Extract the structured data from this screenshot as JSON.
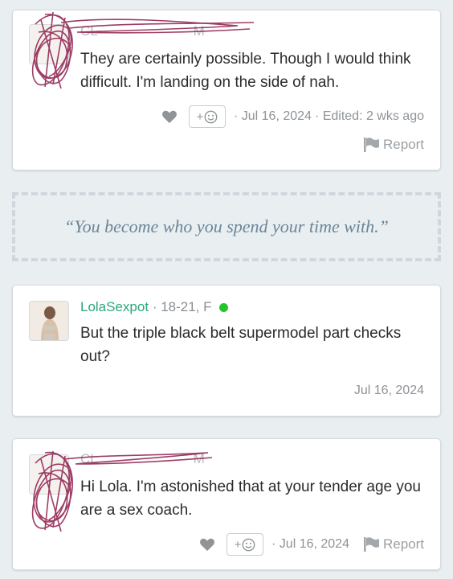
{
  "posts": [
    {
      "username_redacted": "CL",
      "meta_suffix": "M",
      "body": "They are certainly possible. Though I would think difficult. I'm landing on the side of nah.",
      "react_label": "+",
      "date": "· Jul 16, 2024",
      "edited": "· Edited: 2 wks ago",
      "report_label": "Report"
    },
    {
      "username": "LolaSexpot",
      "age_gender": "· 18-21, F",
      "body": "But the triple black belt supermodel part checks out?",
      "date": "Jul 16, 2024"
    },
    {
      "username_redacted": "CL",
      "meta_suffix": "M",
      "body": "Hi Lola. I'm astonished that at your tender age you are a sex coach.",
      "react_label": "+",
      "date": "· Jul 16, 2024",
      "report_label": "Report"
    }
  ],
  "quote": "“You become who you spend your time with.”",
  "colors": {
    "background": "#e9eef1",
    "username": "#2ba57f",
    "quote": "#6b8597",
    "online": "#22c52a",
    "scribble": "#8d1c4a"
  },
  "icons": [
    "heart-icon",
    "smiley-icon",
    "flag-icon",
    "online-dot"
  ]
}
